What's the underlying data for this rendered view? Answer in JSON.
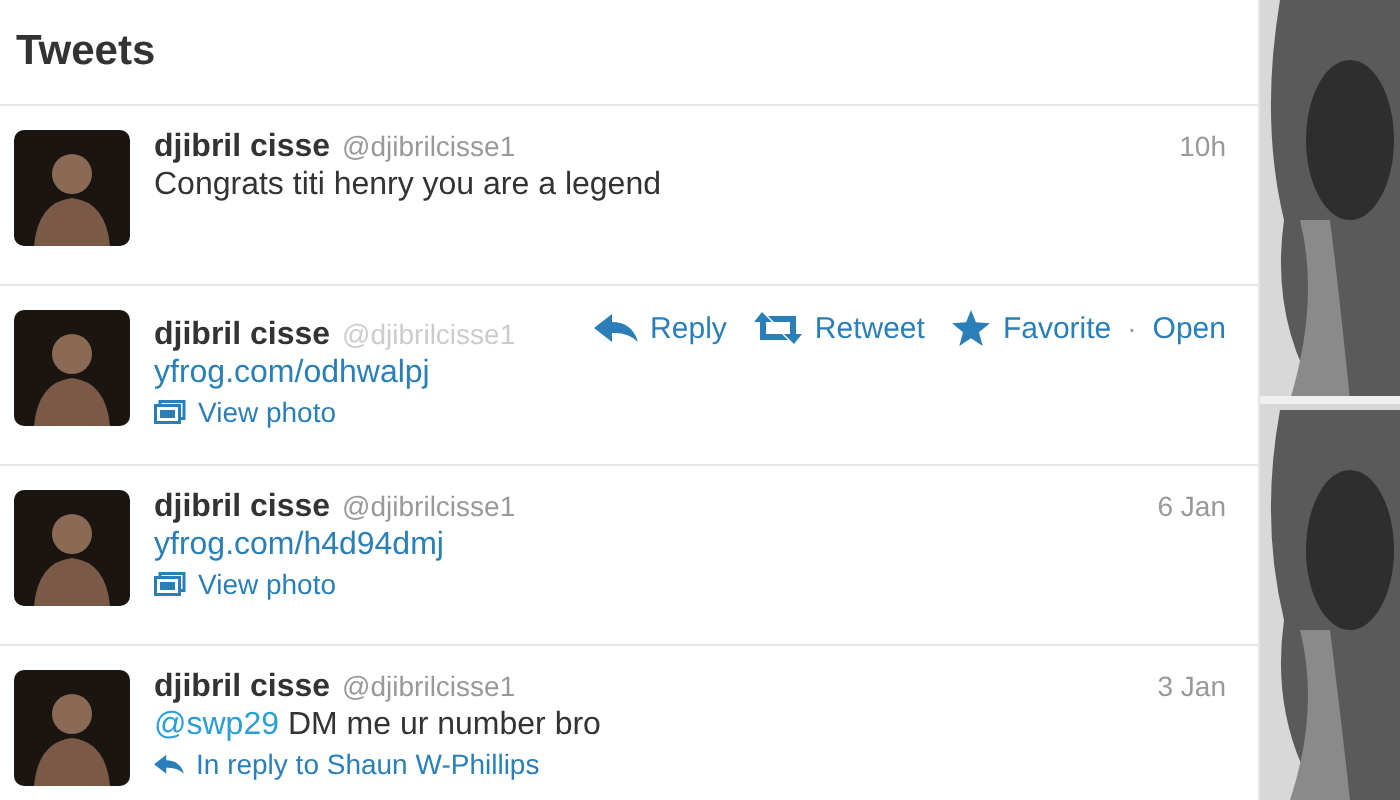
{
  "header": {
    "title": "Tweets"
  },
  "tweets": [
    {
      "name": "djibril cisse",
      "handle": "@djibrilcisse1",
      "time": "10h",
      "text": "Congrats titi henry you are a legend"
    },
    {
      "name": "djibril cisse",
      "handle": "@djibrilcisse1",
      "link": "yfrog.com/odhwalpj",
      "media_label": "View photo",
      "actions": [
        {
          "kind": "reply",
          "label": "Reply"
        },
        {
          "kind": "retweet",
          "label": "Retweet"
        },
        {
          "kind": "favorite",
          "label": "Favorite"
        },
        {
          "kind": "separator",
          "label": "·"
        },
        {
          "kind": "open",
          "label": "Open"
        }
      ]
    },
    {
      "name": "djibril cisse",
      "handle": "@djibrilcisse1",
      "time": "6 Jan",
      "link": "yfrog.com/h4d94dmj",
      "media_label": "View photo"
    },
    {
      "name": "djibril cisse",
      "handle": "@djibrilcisse1",
      "time": "3 Jan",
      "mention": "@swp29",
      "text": "DM me ur number bro",
      "in_reply_to": "In reply to Shaun W-Phillips"
    }
  ]
}
